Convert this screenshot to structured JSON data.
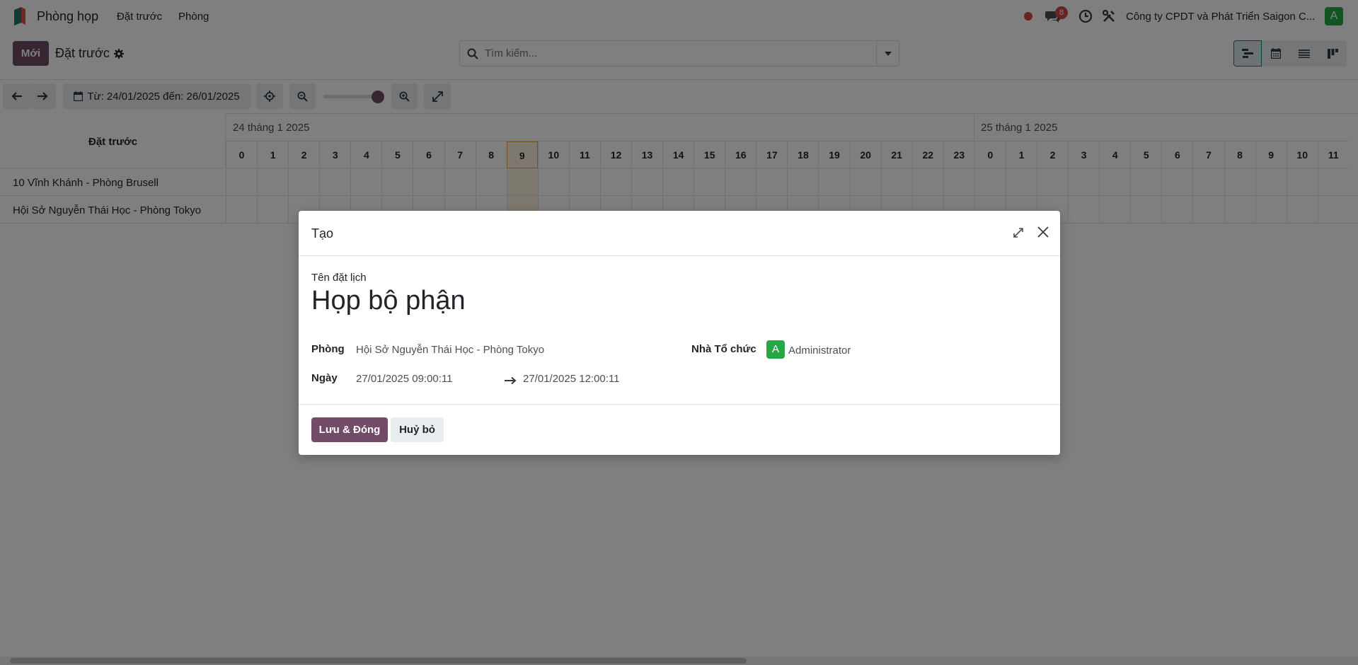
{
  "navbar": {
    "app_name": "Phòng họp",
    "menu": [
      "Đặt trước",
      "Phòng"
    ],
    "message_count": "8",
    "company": "Công ty CPDT và Phát Triển Saigon C...",
    "user_initial": "A",
    "icons": [
      "app-logo",
      "recording-dot",
      "chat-icon",
      "clock-icon",
      "tools-icon"
    ]
  },
  "control_panel": {
    "new_label": "Mới",
    "breadcrumb": "Đặt trước",
    "search_placeholder": "Tìm kiếm...",
    "views": [
      "gantt-view",
      "calendar-view",
      "list-view",
      "kanban-view"
    ]
  },
  "gantt_toolbar": {
    "range_label": "Từ: 24/01/2025 đến: 26/01/2025"
  },
  "gantt": {
    "corner_label": "Đặt trước",
    "days": [
      "24 tháng 1 2025",
      "25 tháng 1 2025"
    ],
    "hours": [
      "0",
      "1",
      "2",
      "3",
      "4",
      "5",
      "6",
      "7",
      "8",
      "9",
      "10",
      "11",
      "12",
      "13",
      "14",
      "15",
      "16",
      "17",
      "18",
      "19",
      "20",
      "21",
      "22",
      "23",
      "0",
      "1",
      "2",
      "3",
      "4",
      "5",
      "6",
      "7",
      "8",
      "9",
      "10",
      "11"
    ],
    "highlight_hour_index": 9,
    "rows": [
      "10 Vĩnh Khánh - Phòng Brusell",
      "Hội Sở Nguyễn Thái Học - Phòng Tokyo"
    ]
  },
  "dialog": {
    "title": "Tạo",
    "name_label": "Tên đặt lịch",
    "name_value": "Họp bộ phận",
    "room_label": "Phòng",
    "room_value": "Hội Sở Nguyễn Thái Học - Phòng Tokyo",
    "date_label": "Ngày",
    "start_value": "27/01/2025 09:00:11",
    "end_value": "27/01/2025 12:00:11",
    "organizer_label": "Nhà Tổ chức",
    "organizer_initial": "A",
    "organizer_value": "Administrator",
    "save_label": "Lưu & Đóng",
    "cancel_label": "Huỷ bỏ"
  },
  "colors": {
    "brand": "#714b67",
    "avatar": "#28a745",
    "today_highlight": "#fcf3dd",
    "badge": "#d64545"
  }
}
